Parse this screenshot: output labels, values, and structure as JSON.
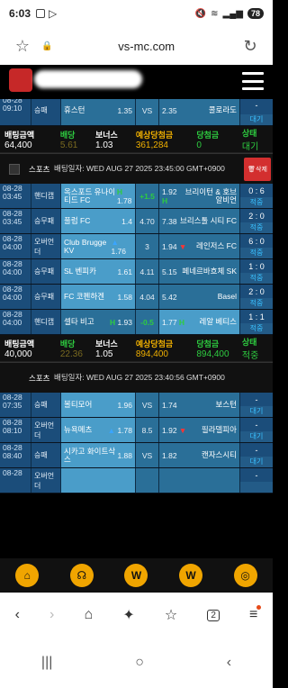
{
  "status": {
    "time": "6:03",
    "battery": "78"
  },
  "browser": {
    "url": "vs-mc.com"
  },
  "top_partial_row": {
    "date": "08-28 09:10",
    "type": "승패",
    "home": "휴스턴",
    "home_odd": "1.35",
    "mid": "VS",
    "away_odd": "2.35",
    "away": "콜로라도",
    "score": "-",
    "status": "대기"
  },
  "summary1": {
    "bet_label": "배팅금액",
    "bet_value": "64,400",
    "odds_label": "배당",
    "odds_value": "5.61",
    "bonus_label": "보너스",
    "bonus_value": "1.03",
    "expected_label": "예상당첨금",
    "expected_value": "361,284",
    "win_label": "당첨금",
    "win_value": "0",
    "state_label": "상태",
    "state_value": "대기"
  },
  "bet2": {
    "sport": "스포츠",
    "date": "배팅일자: WED AUG 27 2025 23:45:00 GMT+0900",
    "delete": "삭제",
    "rows": [
      {
        "date": "08-28 03:45",
        "type": "핸디캡",
        "home": "옥스포드 유나이티드 FC",
        "hmark": "H",
        "home_odd": "1.78",
        "mid": "+1.5",
        "away_odd": "1.92",
        "amark": "H",
        "away": "브리이턴 & 호브 알비언",
        "score": "0 : 6",
        "status": "적중",
        "sel": "home"
      },
      {
        "date": "08-28 03:45",
        "type": "승무패",
        "home": "풀럼 FC",
        "hmark": "",
        "home_odd": "1.4",
        "mid": "4.70",
        "away_odd": "7.38",
        "amark": "",
        "away": "브리스톨 시티 FC",
        "score": "2 : 0",
        "status": "적중",
        "sel": "home"
      },
      {
        "date": "08-28 04:00",
        "type": "오버언더",
        "home": "Club Brugge KV",
        "hmark": "▲",
        "home_odd": "1.76",
        "mid": "3",
        "away_odd": "1.94",
        "amark": "▼",
        "away": "레인저스 FC",
        "score": "6 : 0",
        "status": "적중",
        "sel": "home"
      },
      {
        "date": "08-28 04:00",
        "type": "승무패",
        "home": "SL 벤피카",
        "hmark": "",
        "home_odd": "1.61",
        "mid": "4.11",
        "away_odd": "5.15",
        "amark": "",
        "away": "페네르바흐체 SK",
        "score": "1 : 0",
        "status": "적중",
        "sel": "home"
      },
      {
        "date": "08-28 04:00",
        "type": "승무패",
        "home": "FC 코펜하겐",
        "hmark": "",
        "home_odd": "1.58",
        "mid": "4.04",
        "away_odd": "5.42",
        "amark": "",
        "away": "Basel",
        "score": "2 : 0",
        "status": "적중",
        "sel": "home"
      },
      {
        "date": "08-28 04:00",
        "type": "핸디캡",
        "home": "셀타 비고",
        "hmark": "H",
        "home_odd": "1.93",
        "mid": "-0.5",
        "away_odd": "1.77",
        "amark": "H",
        "away": "레알 베티스",
        "score": "1 : 1",
        "status": "적중",
        "sel": "away"
      }
    ]
  },
  "summary2": {
    "bet_label": "배팅금액",
    "bet_value": "40,000",
    "odds_label": "배당",
    "odds_value": "22.36",
    "bonus_label": "보너스",
    "bonus_value": "1.05",
    "expected_label": "예상당첨금",
    "expected_value": "894,400",
    "win_label": "당첨금",
    "win_value": "894,400",
    "state_label": "상태",
    "state_value": "적중"
  },
  "bet3": {
    "sport": "스포츠",
    "date": "배팅일자: WED AUG 27 2025 23:40:56 GMT+0900",
    "rows": [
      {
        "date": "08-28 07:35",
        "type": "승패",
        "home": "볼티모어",
        "hmark": "",
        "home_odd": "1.96",
        "mid": "VS",
        "away_odd": "1.74",
        "amark": "",
        "away": "보스턴",
        "score": "-",
        "status": "대기",
        "sel": "home"
      },
      {
        "date": "08-28 08:10",
        "type": "오버언더",
        "home": "뉴욕메츠",
        "hmark": "▲",
        "home_odd": "1.78",
        "mid": "8.5",
        "away_odd": "1.92",
        "amark": "▼",
        "away": "필라델피아",
        "score": "-",
        "status": "대기",
        "sel": "home"
      },
      {
        "date": "08-28 08:40",
        "type": "승패",
        "home": "시카고 화이트삭스",
        "hmark": "",
        "home_odd": "1.88",
        "mid": "VS",
        "away_odd": "1.82",
        "amark": "",
        "away": "캔자스시티",
        "score": "-",
        "status": "대기",
        "sel": "home"
      },
      {
        "date": "08-28",
        "type": "오버언더",
        "home": "",
        "hmark": "",
        "home_odd": "",
        "mid": "",
        "away_odd": "",
        "amark": "",
        "away": "",
        "score": "-",
        "status": "",
        "sel": "home"
      }
    ]
  },
  "icons": {
    "site_bar": [
      "home-icon",
      "headset-icon",
      "w-coin-icon",
      "w-coin-icon",
      "globe-ball-icon"
    ],
    "browser_bar": [
      "back-icon",
      "forward-icon",
      "home-icon",
      "sparkle-icon",
      "bookmark-icon",
      "tabs-icon",
      "menu-icon"
    ],
    "tabs_count": "2"
  }
}
